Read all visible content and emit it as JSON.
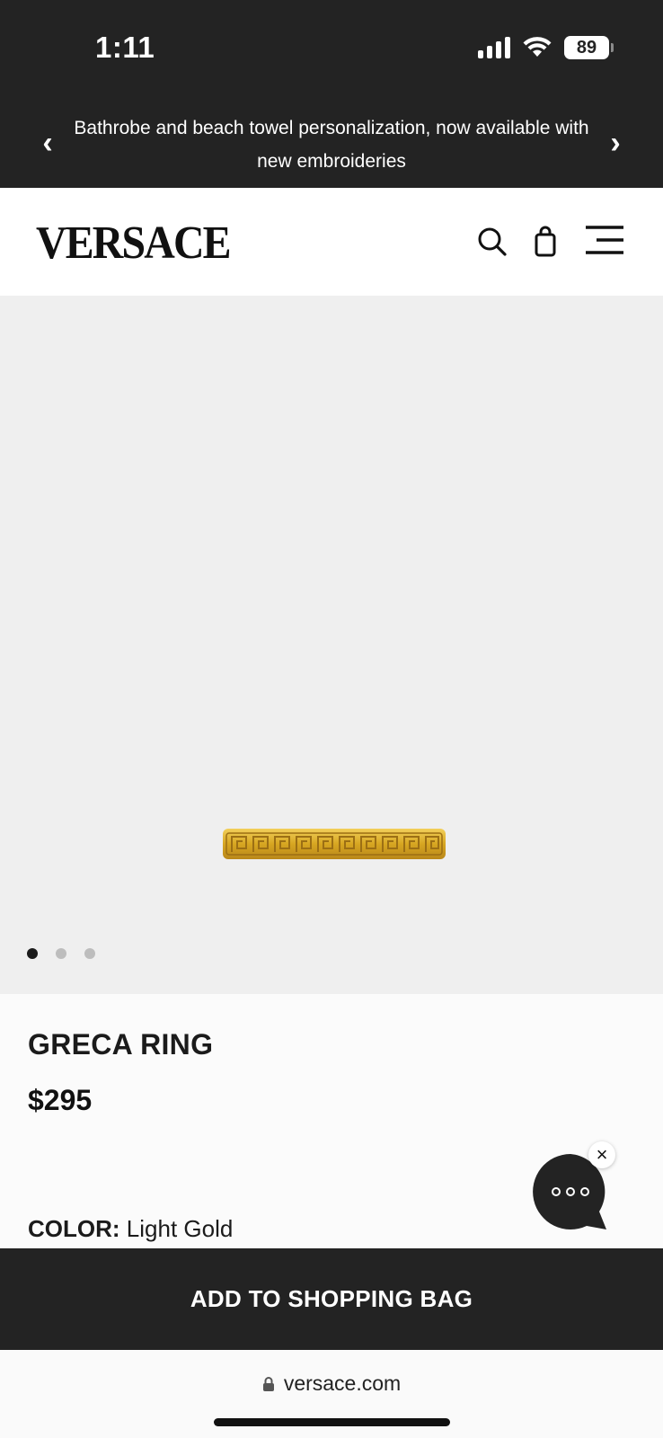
{
  "status": {
    "time": "1:11",
    "battery": "89"
  },
  "promo": {
    "text": "Bathrobe and beach towel personalization, now available with new embroideries",
    "prev": "‹",
    "next": "›"
  },
  "header": {
    "logo": "VERSACE"
  },
  "gallery": {
    "image_count": 3,
    "active_index": 0
  },
  "product": {
    "name": "GRECA RING",
    "price": "$295",
    "color_label": "COLOR:",
    "color_value": "Light Gold"
  },
  "chat": {
    "close": "×"
  },
  "cta": {
    "add_to_bag": "ADD TO SHOPPING BAG"
  },
  "browser": {
    "url": "versace.com"
  },
  "colors": {
    "dark": "#232323",
    "image_bg": "#efefef",
    "gold": "#d7a621"
  }
}
